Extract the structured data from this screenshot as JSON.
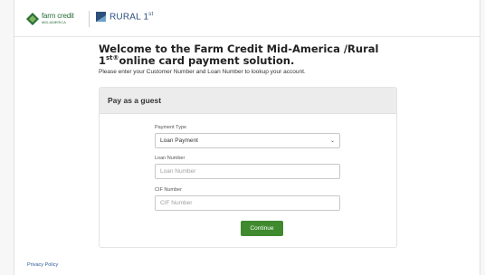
{
  "header": {
    "farm_credit_logo": {
      "line1": "farm credit",
      "line2": "MID-AMERICA",
      "icon": "diamond-leaf-icon"
    },
    "rural_logo": {
      "text": "RURAL 1",
      "sup": "st",
      "icon": "rural1-square-icon"
    }
  },
  "page": {
    "title_part1": "Welcome to the Farm Credit Mid-America /Rural 1",
    "title_sup": "st®",
    "title_part2": "online card payment solution.",
    "subtitle": "Please enter your Customer Number and Loan Number to lookup your account."
  },
  "card": {
    "header": "Pay as a guest",
    "payment_type": {
      "label": "Payment Type",
      "value": "Loan Payment",
      "icon": "chevron-down-icon"
    },
    "loan_number": {
      "label": "Loan Number",
      "placeholder": "Loan Number"
    },
    "cif_number": {
      "label": "CIF Number",
      "placeholder": "CIF Number"
    },
    "continue_label": "Continue"
  },
  "footer": {
    "privacy_policy": "Privacy Policy"
  },
  "colors": {
    "brand_green": "#2b6e39",
    "brand_blue": "#2c4f7c",
    "button_green": "#3f8a2f",
    "link_blue": "#2c5a96"
  }
}
